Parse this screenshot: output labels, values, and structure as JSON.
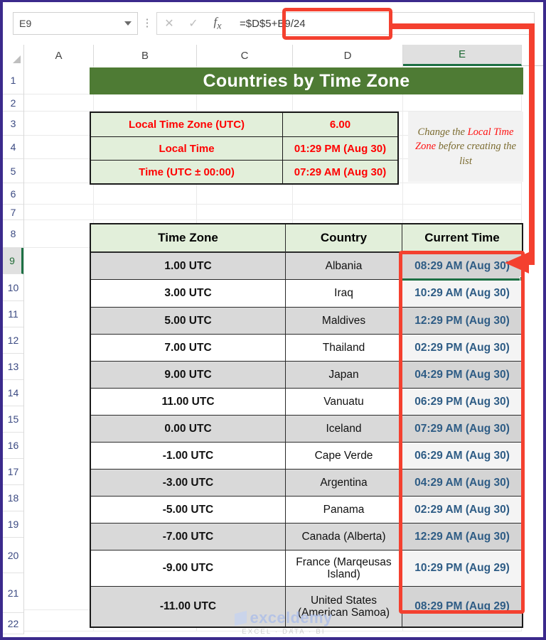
{
  "app": {
    "name_box_value": "E9",
    "formula_value": "=$D$5+B9/24",
    "cancel_icon": "close-icon",
    "confirm_icon": "check-icon",
    "function_icon": "fx-icon",
    "dropdown_icon": "chevron-down-icon",
    "accent_green": "#4E7B34",
    "accent_red": "#F4402F",
    "selection_green": "#1D7044"
  },
  "grid": {
    "columns": [
      "A",
      "B",
      "C",
      "D",
      "E"
    ],
    "selected_column": "E",
    "rows": [
      "1",
      "2",
      "3",
      "4",
      "5",
      "6",
      "7",
      "8",
      "9",
      "10",
      "11",
      "12",
      "13",
      "14",
      "15",
      "16",
      "17",
      "18",
      "19",
      "20",
      "21",
      "22"
    ],
    "selected_row": "9"
  },
  "sheet": {
    "title": "Countries by Time Zone",
    "info": [
      {
        "label": "Local Time Zone (UTC)",
        "value": "6.00"
      },
      {
        "label": "Local Time",
        "value": "01:29 PM (Aug 30)"
      },
      {
        "label": "Time (UTC ± 00:00)",
        "value": "07:29 AM (Aug 30)"
      }
    ],
    "note": {
      "part1": "Change the ",
      "em1": "Local",
      "part2": " ",
      "em2": "Time Zone",
      "part3": " before creating the list"
    },
    "table": {
      "headers": [
        "Time Zone",
        "Country",
        "Current Time"
      ],
      "rows": [
        {
          "zone": "1.00 UTC",
          "country": "Albania",
          "time": "08:29 AM (Aug 30)"
        },
        {
          "zone": "3.00 UTC",
          "country": "Iraq",
          "time": "10:29 AM (Aug 30)"
        },
        {
          "zone": "5.00 UTC",
          "country": "Maldives",
          "time": "12:29 PM (Aug 30)"
        },
        {
          "zone": "7.00 UTC",
          "country": "Thailand",
          "time": "02:29 PM (Aug 30)"
        },
        {
          "zone": "9.00 UTC",
          "country": "Japan",
          "time": "04:29 PM (Aug 30)"
        },
        {
          "zone": "11.00 UTC",
          "country": "Vanuatu",
          "time": "06:29 PM (Aug 30)"
        },
        {
          "zone": "0.00 UTC",
          "country": "Iceland",
          "time": "07:29 AM (Aug 30)"
        },
        {
          "zone": "-1.00 UTC",
          "country": "Cape Verde",
          "time": "06:29 AM (Aug 30)"
        },
        {
          "zone": "-3.00 UTC",
          "country": "Argentina",
          "time": "04:29 AM (Aug 30)"
        },
        {
          "zone": "-5.00 UTC",
          "country": "Panama",
          "time": "02:29 AM (Aug 30)"
        },
        {
          "zone": "-7.00 UTC",
          "country": "Canada (Alberta)",
          "time": "12:29 AM (Aug 30)"
        },
        {
          "zone": "-9.00 UTC",
          "country": "France (Marqeusas Island)",
          "time": "10:29 PM (Aug 29)"
        },
        {
          "zone": "-11.00 UTC",
          "country": "United States (American Samoa)",
          "time": "08:29 PM (Aug 29)"
        }
      ]
    }
  },
  "watermark": {
    "main": "exceldemy",
    "sub": "EXCEL · DATA · BI"
  }
}
